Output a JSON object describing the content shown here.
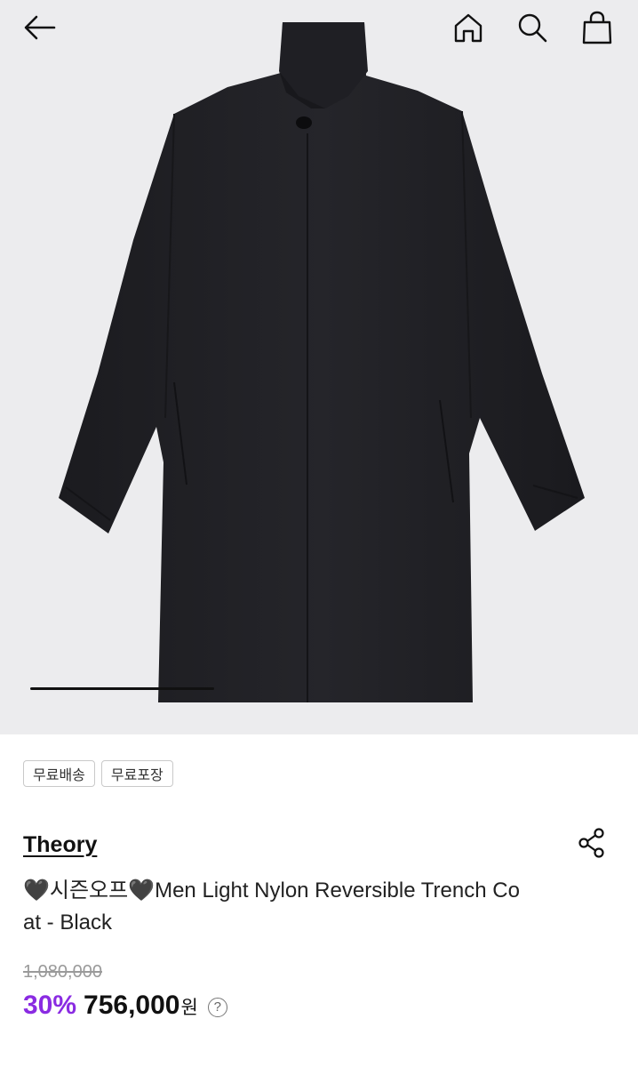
{
  "header": {
    "back_icon": "arrow-left-icon",
    "home_icon": "home-icon",
    "search_icon": "search-icon",
    "bag_icon": "shopping-bag-icon"
  },
  "gallery": {
    "image_description_icon": "black-coat-image",
    "background_color": "#ececee",
    "progress": 0.3
  },
  "tags": [
    {
      "label": "무료배송"
    },
    {
      "label": "무료포장"
    }
  ],
  "product": {
    "brand": "Theory",
    "title": "🖤시즌오프🖤Men Light Nylon Reversible Trench Coat - Black",
    "original_price": "1,080,000",
    "discount": "30%",
    "price": "756,000",
    "currency": "원",
    "help": "?"
  },
  "colors": {
    "discount": "#8a2be2",
    "text": "#111111",
    "muted": "#9a9a9a"
  }
}
